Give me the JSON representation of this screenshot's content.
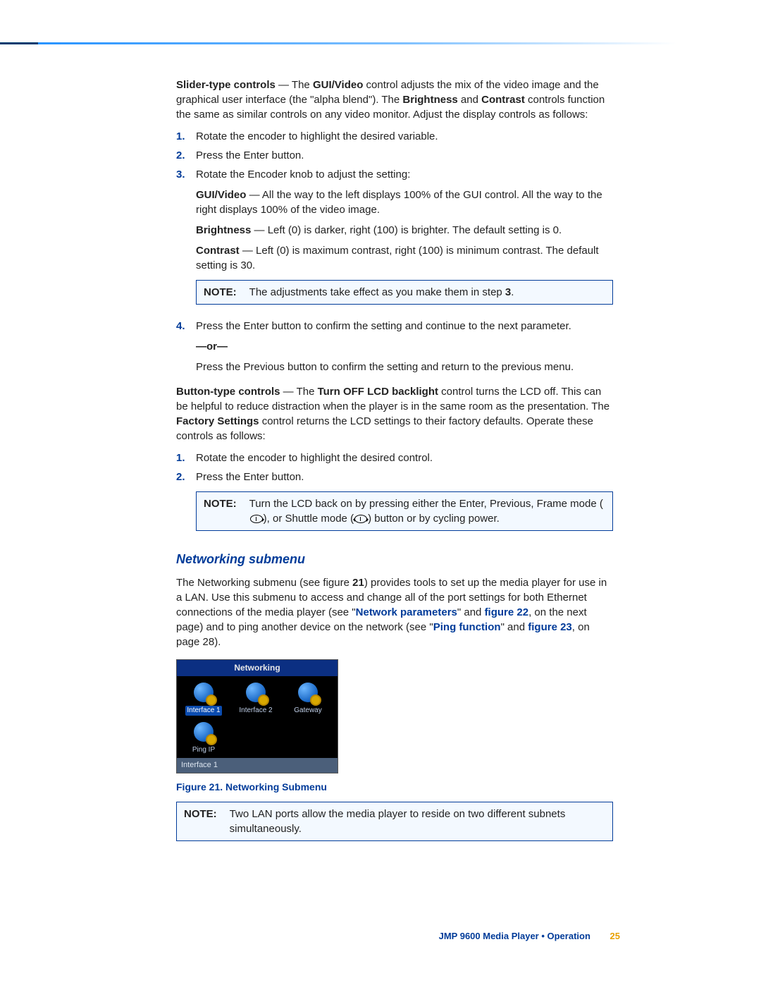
{
  "para_slider": {
    "lead_bold": "Slider-type controls",
    "t1": " — The ",
    "gui_video": "GUI/Video",
    "t2": " control adjusts the mix of the video image and the graphical user interface (the \"alpha blend\"). The ",
    "brightness": "Brightness",
    "t3": " and ",
    "contrast": "Contrast",
    "t4": " controls function the same as similar controls on any video monitor. Adjust the display controls as follows:"
  },
  "list1": {
    "n1": "1.",
    "i1": "Rotate the encoder to highlight the desired variable.",
    "n2": "2.",
    "i2": "Press the Enter button.",
    "n3": "3.",
    "i3": "Rotate the Encoder knob to adjust the setting:",
    "gv_label": "GUI/Video",
    "gv_text": " — All the way to the left displays 100% of the GUI control. All the way to the right displays 100% of the video image.",
    "br_label": "Brightness",
    "br_text": " — Left (0) is darker, right (100) is brighter. The default setting is 0.",
    "ct_label": "Contrast",
    "ct_text": " — Left (0) is maximum contrast, right (100) is minimum contrast. The default setting is 30."
  },
  "note1": {
    "label": "NOTE:",
    "t1": "The adjustments take effect as you make them in step ",
    "step": "3",
    "t2": "."
  },
  "list1b": {
    "n4": "4.",
    "i4": "Press the Enter button to confirm the setting and continue to the next parameter.",
    "or": "—or—",
    "i4b": "Press the Previous button to confirm the setting and return to the previous menu."
  },
  "para_button": {
    "lead_bold": "Button-type controls",
    "t1": " — The ",
    "turnoff": "Turn OFF LCD backlight",
    "t2": " control turns the LCD off. This can be helpful to reduce distraction when the player is in the same room as the presentation. The ",
    "factory": "Factory Settings",
    "t3": " control returns the LCD settings to their factory defaults. Operate these controls as follows:"
  },
  "list2": {
    "n1": "1.",
    "i1": "Rotate the encoder to highlight the desired control.",
    "n2": "2.",
    "i2": "Press the Enter button."
  },
  "note2": {
    "label": "NOTE:",
    "t1": "Turn the LCD back on by pressing either the Enter, Previous, Frame mode (",
    "t2": "), or Shuttle mode (",
    "t3": ") button or by cycling power."
  },
  "section_heading": "Networking submenu",
  "para_net": {
    "t1": "The Networking submenu (see figure ",
    "fig21": "21",
    "t2": ") provides tools to set up the media player for use in a LAN. Use this submenu to access and change all of the port settings for both Ethernet connections of the media player (see \"",
    "link_np": "Network parameters",
    "t3": "\" and ",
    "link_f22": "figure 22",
    "t4": ", on the next page) and to ping another device on the network (see \"",
    "link_pf": "Ping function",
    "t5": "\" and ",
    "link_f23": "figure 23",
    "t6": ", on page 28)."
  },
  "figure": {
    "title": "Networking",
    "icon1": "Interface 1",
    "icon2": "Interface 2",
    "icon3": "Gateway",
    "icon4": "Ping IP",
    "status": "Interface 1",
    "caption": "Figure 21. Networking Submenu"
  },
  "note3": {
    "label": "NOTE:",
    "text": "Two LAN ports allow the media player to reside on two different subnets simultaneously."
  },
  "footer": {
    "text": "JMP 9600 Media Player • Operation",
    "page": "25"
  }
}
